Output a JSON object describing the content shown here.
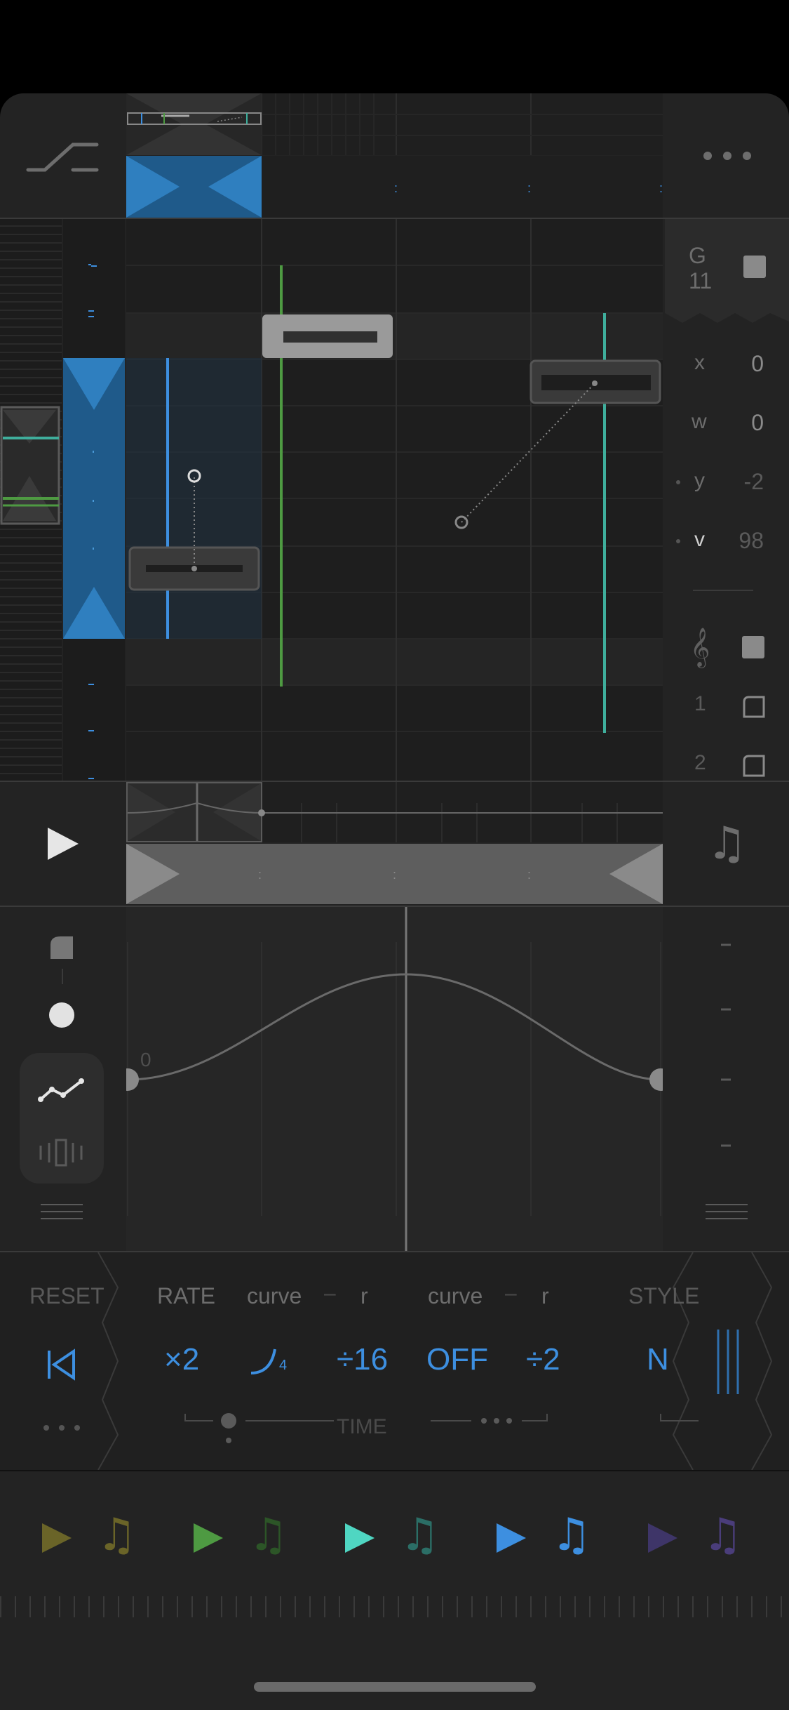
{
  "colors": {
    "background": "#000000",
    "panel": "#232323",
    "blue": "#3d8fe0",
    "green": "#4e9a42",
    "teal": "#3fae9c",
    "olive": "#6a6428",
    "purple": "#4a3d7a"
  },
  "note_info": {
    "note": "G",
    "octave": "11"
  },
  "params": [
    {
      "key": "x",
      "value": "0"
    },
    {
      "key": "w",
      "value": "0"
    },
    {
      "key": "y",
      "value": "-2"
    },
    {
      "key": "v",
      "value": "98"
    }
  ],
  "tracks": [
    "1",
    "2"
  ],
  "curve": {
    "start_label": "0"
  },
  "controls": {
    "reset": "RESET",
    "rate": "RATE",
    "curve1": "curve",
    "dash1": "–",
    "r1": "r",
    "curve2": "curve",
    "dash2": "–",
    "r2": "r",
    "style": "STYLE",
    "rate_value": "×2",
    "curve1_value_sub": "4",
    "r1_value": "÷16",
    "curve2_value": "OFF",
    "r2_value": "÷2",
    "style_value": "N",
    "time": "TIME"
  },
  "players": [
    {
      "name": "player-1",
      "color": "#6a6428"
    },
    {
      "name": "player-2",
      "color": "#4e9a42"
    },
    {
      "name": "player-3",
      "color": "#3fae9c"
    },
    {
      "name": "player-4",
      "color": "#3d8fe0"
    },
    {
      "name": "player-5",
      "color": "#4a3d7a"
    }
  ]
}
